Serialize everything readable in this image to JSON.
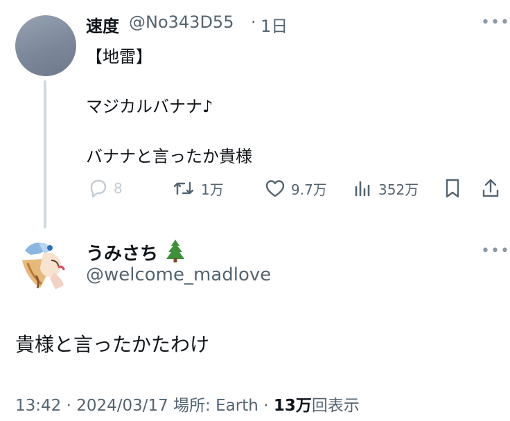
{
  "parent": {
    "name": "速度",
    "handle": "@No343D55",
    "separator": "·",
    "time": "1日",
    "lines": [
      "【地雷】",
      "マジカルバナナ♪",
      "バナナと言ったか貴様"
    ],
    "more_icon": "more-horizontal-icon",
    "actions": {
      "reply": "8",
      "retweet": "1万",
      "like": "9.7万",
      "views": "352万"
    }
  },
  "reply": {
    "name": "うみさち",
    "name_emoji": "evergreen-tree-icon",
    "handle": "@welcome_madlove",
    "text": "貴様と言ったかたわけ",
    "meta": {
      "time": "13:42",
      "sep1": "·",
      "date": "2024/03/17",
      "location_label": "場所: Earth",
      "sep2": "·",
      "views_count": "13万",
      "views_label": "回表示"
    }
  },
  "colors": {
    "text": "#0f1419",
    "secondary": "#536471",
    "thread_line": "#cfd9de"
  }
}
